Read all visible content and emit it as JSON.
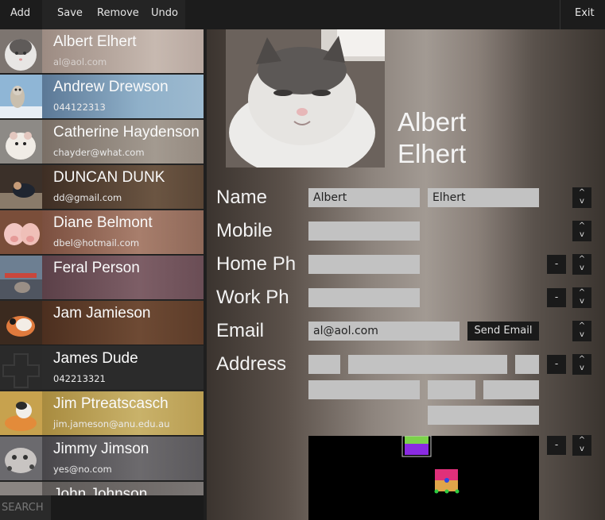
{
  "toolbar": {
    "add": "Add",
    "save": "Save",
    "remove": "Remove",
    "undo": "Undo",
    "exit": "Exit"
  },
  "contacts": [
    {
      "name": "Albert Elhert",
      "sub": "al@aol.com",
      "bg": "#b9a59a"
    },
    {
      "name": "Andrew Drewson",
      "sub": "044122313",
      "bg": "#6b8aa6"
    },
    {
      "name": "Catherine Haydenson",
      "sub": "chayder@what.com",
      "bg": "#8f8377"
    },
    {
      "name": "DUNCAN DUNK",
      "sub": "dd@gmail.com",
      "bg": "#4d3a2e"
    },
    {
      "name": "Diane Belmont",
      "sub": "dbel@hotmail.com",
      "bg": "#8b6656"
    },
    {
      "name": "Feral Person",
      "sub": "",
      "bg": "#6e5055"
    },
    {
      "name": "Jam Jamieson",
      "sub": "",
      "bg": "#5a3a26"
    },
    {
      "name": "James Dude",
      "sub": "042213321",
      "bg": "#2d2d2d"
    },
    {
      "name": "Jim Ptreatscasch",
      "sub": "jim.jameson@anu.edu.au",
      "bg": "#b59d55"
    },
    {
      "name": "Jimmy Jimson",
      "sub": "yes@no.com",
      "bg": "#4e4a4c"
    },
    {
      "name": "John Johnson",
      "sub": "",
      "bg": "#6a6868"
    }
  ],
  "search": {
    "label": "SEARCH"
  },
  "detail": {
    "first_line": "Albert",
    "second_line": "Elhert",
    "labels": {
      "name": "Name",
      "mobile": "Mobile",
      "home": "Home Ph",
      "work": "Work Ph",
      "email": "Email",
      "address": "Address"
    },
    "first_name": "Albert",
    "last_name": "Elhert",
    "email": "al@aol.com",
    "send_email": "Send Email",
    "minus": "-",
    "up": "^",
    "down": "v"
  }
}
